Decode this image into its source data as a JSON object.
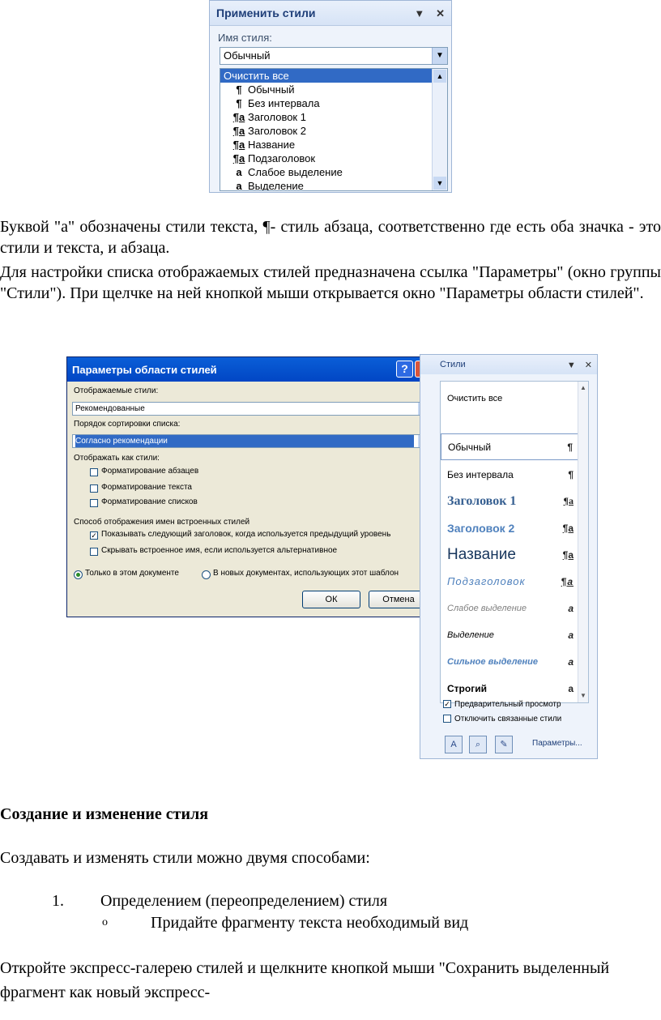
{
  "apply_styles_panel": {
    "title": "Применить стили",
    "dropdown_icon": "▼",
    "close_icon": "✕",
    "style_name_label": "Имя стиля:",
    "style_name_value": "Обычный",
    "list": [
      {
        "icon": "",
        "label": "Очистить все",
        "selected": true
      },
      {
        "icon": "¶",
        "label": "Обычный"
      },
      {
        "icon": "¶",
        "label": "Без интервала"
      },
      {
        "icon": "¶a",
        "label": "Заголовок 1"
      },
      {
        "icon": "¶a",
        "label": "Заголовок 2"
      },
      {
        "icon": "¶a",
        "label": "Название"
      },
      {
        "icon": "¶a",
        "label": "Подзаголовок"
      },
      {
        "icon": "a",
        "label": "Слабое выделение"
      },
      {
        "icon": "a",
        "label": "Выделение"
      }
    ]
  },
  "text": {
    "p1": "Буквой \"а\" обозначены стили текста, ¶- стиль абзаца, соответственно где есть оба значка - это стили и текста, и абзаца.",
    "p2": "Для настройки списка отображаемых стилей предназначена ссылка \"Параметры\" (окно группы \"Стили\"). При щелчке на ней кнопкой мыши открывается окно \"Параметры области стилей\".",
    "heading": "Создание и изменение стиля",
    "p3": "Создавать и изменять стили можно двумя способами:",
    "list_num": "1.",
    "list_item": "Определением (переопределением) стиля",
    "sub_bullet": "o",
    "sub_item": "Придайте фрагменту текста необходимый вид",
    "p4": "Откройте экспресс-галерею стилей и щелкните кнопкой мыши \"Сохранить выделенный фрагмент как новый экспресс-"
  },
  "dialog": {
    "title": "Параметры области стилей",
    "help_icon": "?",
    "close_icon": "✕",
    "shown_styles_label": "Отображаемые стили:",
    "shown_styles_value": "Рекомендованные",
    "sort_label": "Порядок сортировки списка:",
    "sort_value": "Согласно рекомендации",
    "show_as_label": "Отображать как стили:",
    "cb_paragraph": "Форматирование абзацев",
    "cb_text": "Форматирование текста",
    "cb_lists": "Форматирование списков",
    "builtin_label": "Способ отображения имен встроенных стилей",
    "cb_next_heading": "Показывать следующий заголовок, когда используется предыдущий уровень",
    "cb_next_heading_checked": true,
    "cb_hide_builtin": "Скрывать встроенное имя, если используется альтернативное",
    "rb_this_doc": "Только в этом документе",
    "rb_new_docs": "В новых документах, использующих этот шаблон",
    "ok": "ОК",
    "cancel": "Отмена"
  },
  "styles_pane": {
    "title": "Стили",
    "dropdown_icon": "▼",
    "close_icon": "✕",
    "items": [
      {
        "label": "Очистить все",
        "mark": ""
      },
      {
        "label": "Обычный",
        "mark": "¶"
      },
      {
        "label": "Без интервала",
        "mark": "¶"
      },
      {
        "label": "Заголовок 1",
        "mark": "¶a"
      },
      {
        "label": "Заголовок 2",
        "mark": "¶a"
      },
      {
        "label": "Название",
        "mark": "¶a"
      },
      {
        "label": "Подзаголовок",
        "mark": "¶a"
      },
      {
        "label": "Слабое выделение",
        "mark": "a"
      },
      {
        "label": "Выделение",
        "mark": "a"
      },
      {
        "label": "Сильное выделение",
        "mark": "a"
      },
      {
        "label": "Строгий",
        "mark": "a"
      }
    ],
    "preview": "Предварительный просмотр",
    "preview_checked": true,
    "disable_linked": "Отключить связанные стили",
    "parameters_link": "Параметры..."
  }
}
